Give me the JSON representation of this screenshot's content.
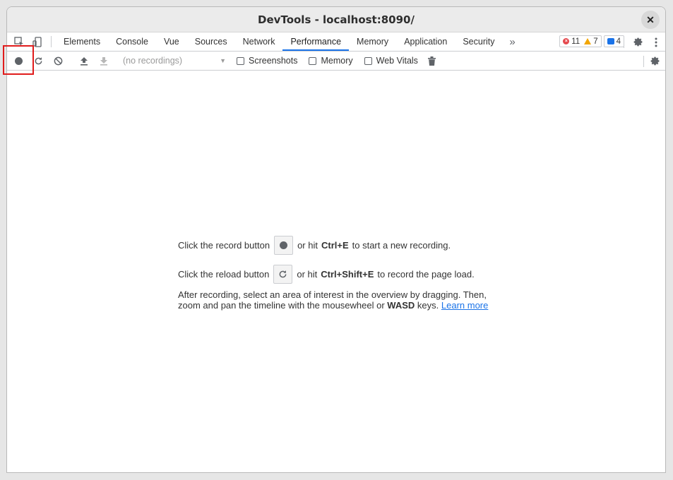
{
  "window": {
    "title": "DevTools - localhost:8090/"
  },
  "tabs": [
    {
      "label": "Elements"
    },
    {
      "label": "Console"
    },
    {
      "label": "Vue"
    },
    {
      "label": "Sources"
    },
    {
      "label": "Network"
    },
    {
      "label": "Performance",
      "active": true
    },
    {
      "label": "Memory"
    },
    {
      "label": "Application"
    },
    {
      "label": "Security"
    }
  ],
  "badges": {
    "errors": "11",
    "warnings": "7",
    "messages": "4"
  },
  "toolbar": {
    "recordings_placeholder": "(no recordings)",
    "screenshots_label": "Screenshots",
    "memory_label": "Memory",
    "webvitals_label": "Web Vitals"
  },
  "landing": {
    "record_prefix": "Click the record button",
    "record_mid": "or hit",
    "record_shortcut": "Ctrl+E",
    "record_suffix": "to start a new recording.",
    "reload_prefix": "Click the reload button",
    "reload_mid": "or hit",
    "reload_shortcut": "Ctrl+Shift+E",
    "reload_suffix": "to record the page load.",
    "para_part1": "After recording, select an area of interest in the overview by dragging. Then, zoom and pan the timeline with the mousewheel or",
    "para_bold": "WASD",
    "para_part2": "keys.",
    "learn_more": "Learn more"
  },
  "colors": {
    "accent": "#1a73e8",
    "highlight": "#e01c1c",
    "error": "#e5484d",
    "warning": "#f2a600"
  }
}
